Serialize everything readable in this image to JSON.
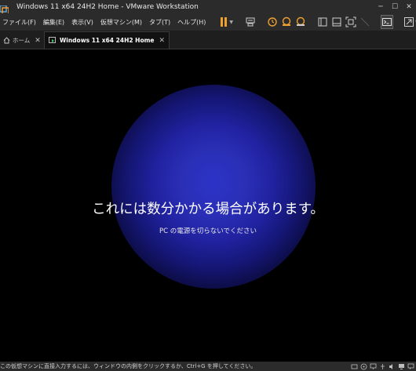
{
  "window": {
    "title": "Windows 11 x64 24H2 Home - VMware Workstation",
    "controls": {
      "minimize": "─",
      "maximize": "☐",
      "close": "✕"
    }
  },
  "menu": {
    "items": [
      {
        "label": "ファイル(F)"
      },
      {
        "label": "編集(E)"
      },
      {
        "label": "表示(V)"
      },
      {
        "label": "仮想マシン(M)"
      },
      {
        "label": "タブ(T)"
      },
      {
        "label": "ヘルプ(H)"
      }
    ]
  },
  "toolbar": {
    "icons": [
      "pause-icon",
      "send-keys-icon",
      "snapshot-icon",
      "revert-snapshot-icon",
      "snapshot-manager-icon",
      "library-view-icon",
      "thumbnail-view-icon",
      "fit-guest-icon",
      "disabled-stretch-icon",
      "console-icon",
      "full-screen-icon"
    ],
    "accent_color": "#f0a030"
  },
  "tabs": [
    {
      "label": "ホーム",
      "active": false
    },
    {
      "label": "Windows 11 x64 24H2 Home",
      "active": true
    }
  ],
  "guest": {
    "message": "これには数分かかる場合があります。",
    "submessage": "PC の電源を切らないでください",
    "glow_color": "#2d33c7"
  },
  "statusbar": {
    "text": "この仮想マシンに直接入力するには、ウィンドウの内側をクリックするか、Ctrl+G を押してください。",
    "icons": [
      "hdd-icon",
      "cdrom-icon",
      "network-icon",
      "usb-icon",
      "sound-icon",
      "display-icon",
      "message-icon"
    ]
  }
}
